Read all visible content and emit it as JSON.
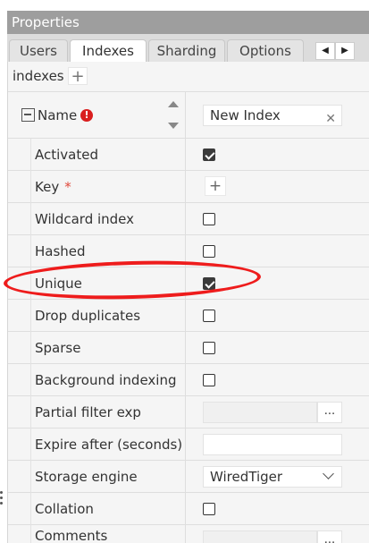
{
  "panel_title": "Properties",
  "tabs": [
    {
      "label": "Users",
      "active": false
    },
    {
      "label": "Indexes",
      "active": true
    },
    {
      "label": "Sharding",
      "active": false
    },
    {
      "label": "Options",
      "active": false
    }
  ],
  "tab_scroll": {
    "left_icon": "◀",
    "right_icon": "▶"
  },
  "indexes_section": {
    "label": "indexes",
    "add_icon": "+"
  },
  "name_row": {
    "label": "Name",
    "error_icon": "!",
    "value": "New Index",
    "clear_icon": "✕"
  },
  "rows": {
    "activated": {
      "label": "Activated",
      "checked": true
    },
    "key": {
      "label": "Key",
      "required_mark": "*",
      "add_icon": "+"
    },
    "wildcard": {
      "label": "Wildcard index",
      "checked": false
    },
    "hashed": {
      "label": "Hashed",
      "checked": false
    },
    "unique": {
      "label": "Unique",
      "checked": true
    },
    "drop_duplicates": {
      "label": "Drop duplicates",
      "checked": false
    },
    "sparse": {
      "label": "Sparse",
      "checked": false
    },
    "background": {
      "label": "Background indexing",
      "checked": false
    },
    "partial_filter": {
      "label": "Partial filter exp",
      "button": "..."
    },
    "expire_after": {
      "label": "Expire after (seconds)",
      "value": ""
    },
    "storage_engine": {
      "label": "Storage engine",
      "value": "WiredTiger"
    },
    "collation": {
      "label": "Collation",
      "checked": false
    },
    "comments": {
      "label": "Comments",
      "button": "..."
    }
  },
  "colors": {
    "title_bar": "#9e9e9e",
    "annotation": "#ee1c1c",
    "error": "#d91e1e"
  }
}
